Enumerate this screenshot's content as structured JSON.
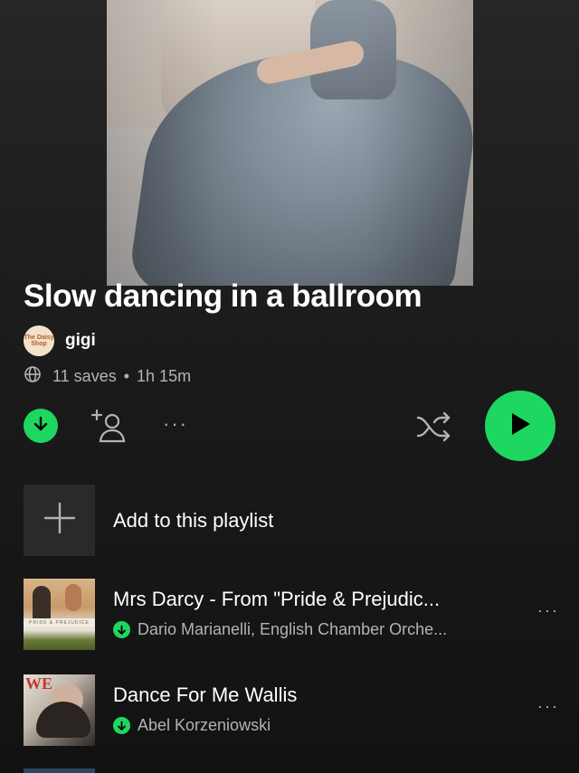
{
  "playlist": {
    "title": "Slow dancing in a ballroom",
    "owner": "gigi",
    "avatar_text": "The Daisy Shop",
    "saves": "11 saves",
    "separator": "•",
    "duration": "1h 15m"
  },
  "actions": {
    "download_icon": "download-icon",
    "add_user_icon": "add-collaborator-icon",
    "more": "···",
    "shuffle_icon": "shuffle-icon",
    "play_icon": "play-icon"
  },
  "add_row": {
    "label": "Add to this playlist"
  },
  "tracks": [
    {
      "title": "Mrs Darcy - From \"Pride & Prejudic...",
      "artist": "Dario Marianelli, English Chamber Orche...",
      "art_text": "PRIDE & PREJUDICE",
      "more": "···"
    },
    {
      "title": "Dance For Me Wallis",
      "artist": "Abel Korzeniowski",
      "art_text": "WE",
      "more": "···"
    }
  ],
  "colors": {
    "accent": "#1ed760",
    "background": "#121212",
    "secondary_text": "#b3b3b3"
  }
}
